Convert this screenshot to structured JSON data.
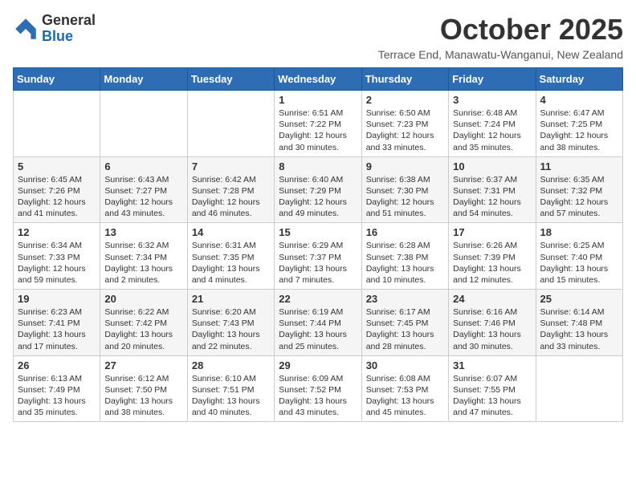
{
  "logo": {
    "general": "General",
    "blue": "Blue"
  },
  "title": "October 2025",
  "subtitle": "Terrace End, Manawatu-Wanganui, New Zealand",
  "header_days": [
    "Sunday",
    "Monday",
    "Tuesday",
    "Wednesday",
    "Thursday",
    "Friday",
    "Saturday"
  ],
  "weeks": [
    [
      {
        "day": "",
        "info": ""
      },
      {
        "day": "",
        "info": ""
      },
      {
        "day": "",
        "info": ""
      },
      {
        "day": "1",
        "info": "Sunrise: 6:51 AM\nSunset: 7:22 PM\nDaylight: 12 hours and 30 minutes."
      },
      {
        "day": "2",
        "info": "Sunrise: 6:50 AM\nSunset: 7:23 PM\nDaylight: 12 hours and 33 minutes."
      },
      {
        "day": "3",
        "info": "Sunrise: 6:48 AM\nSunset: 7:24 PM\nDaylight: 12 hours and 35 minutes."
      },
      {
        "day": "4",
        "info": "Sunrise: 6:47 AM\nSunset: 7:25 PM\nDaylight: 12 hours and 38 minutes."
      }
    ],
    [
      {
        "day": "5",
        "info": "Sunrise: 6:45 AM\nSunset: 7:26 PM\nDaylight: 12 hours and 41 minutes."
      },
      {
        "day": "6",
        "info": "Sunrise: 6:43 AM\nSunset: 7:27 PM\nDaylight: 12 hours and 43 minutes."
      },
      {
        "day": "7",
        "info": "Sunrise: 6:42 AM\nSunset: 7:28 PM\nDaylight: 12 hours and 46 minutes."
      },
      {
        "day": "8",
        "info": "Sunrise: 6:40 AM\nSunset: 7:29 PM\nDaylight: 12 hours and 49 minutes."
      },
      {
        "day": "9",
        "info": "Sunrise: 6:38 AM\nSunset: 7:30 PM\nDaylight: 12 hours and 51 minutes."
      },
      {
        "day": "10",
        "info": "Sunrise: 6:37 AM\nSunset: 7:31 PM\nDaylight: 12 hours and 54 minutes."
      },
      {
        "day": "11",
        "info": "Sunrise: 6:35 AM\nSunset: 7:32 PM\nDaylight: 12 hours and 57 minutes."
      }
    ],
    [
      {
        "day": "12",
        "info": "Sunrise: 6:34 AM\nSunset: 7:33 PM\nDaylight: 12 hours and 59 minutes."
      },
      {
        "day": "13",
        "info": "Sunrise: 6:32 AM\nSunset: 7:34 PM\nDaylight: 13 hours and 2 minutes."
      },
      {
        "day": "14",
        "info": "Sunrise: 6:31 AM\nSunset: 7:35 PM\nDaylight: 13 hours and 4 minutes."
      },
      {
        "day": "15",
        "info": "Sunrise: 6:29 AM\nSunset: 7:37 PM\nDaylight: 13 hours and 7 minutes."
      },
      {
        "day": "16",
        "info": "Sunrise: 6:28 AM\nSunset: 7:38 PM\nDaylight: 13 hours and 10 minutes."
      },
      {
        "day": "17",
        "info": "Sunrise: 6:26 AM\nSunset: 7:39 PM\nDaylight: 13 hours and 12 minutes."
      },
      {
        "day": "18",
        "info": "Sunrise: 6:25 AM\nSunset: 7:40 PM\nDaylight: 13 hours and 15 minutes."
      }
    ],
    [
      {
        "day": "19",
        "info": "Sunrise: 6:23 AM\nSunset: 7:41 PM\nDaylight: 13 hours and 17 minutes."
      },
      {
        "day": "20",
        "info": "Sunrise: 6:22 AM\nSunset: 7:42 PM\nDaylight: 13 hours and 20 minutes."
      },
      {
        "day": "21",
        "info": "Sunrise: 6:20 AM\nSunset: 7:43 PM\nDaylight: 13 hours and 22 minutes."
      },
      {
        "day": "22",
        "info": "Sunrise: 6:19 AM\nSunset: 7:44 PM\nDaylight: 13 hours and 25 minutes."
      },
      {
        "day": "23",
        "info": "Sunrise: 6:17 AM\nSunset: 7:45 PM\nDaylight: 13 hours and 28 minutes."
      },
      {
        "day": "24",
        "info": "Sunrise: 6:16 AM\nSunset: 7:46 PM\nDaylight: 13 hours and 30 minutes."
      },
      {
        "day": "25",
        "info": "Sunrise: 6:14 AM\nSunset: 7:48 PM\nDaylight: 13 hours and 33 minutes."
      }
    ],
    [
      {
        "day": "26",
        "info": "Sunrise: 6:13 AM\nSunset: 7:49 PM\nDaylight: 13 hours and 35 minutes."
      },
      {
        "day": "27",
        "info": "Sunrise: 6:12 AM\nSunset: 7:50 PM\nDaylight: 13 hours and 38 minutes."
      },
      {
        "day": "28",
        "info": "Sunrise: 6:10 AM\nSunset: 7:51 PM\nDaylight: 13 hours and 40 minutes."
      },
      {
        "day": "29",
        "info": "Sunrise: 6:09 AM\nSunset: 7:52 PM\nDaylight: 13 hours and 43 minutes."
      },
      {
        "day": "30",
        "info": "Sunrise: 6:08 AM\nSunset: 7:53 PM\nDaylight: 13 hours and 45 minutes."
      },
      {
        "day": "31",
        "info": "Sunrise: 6:07 AM\nSunset: 7:55 PM\nDaylight: 13 hours and 47 minutes."
      },
      {
        "day": "",
        "info": ""
      }
    ]
  ]
}
